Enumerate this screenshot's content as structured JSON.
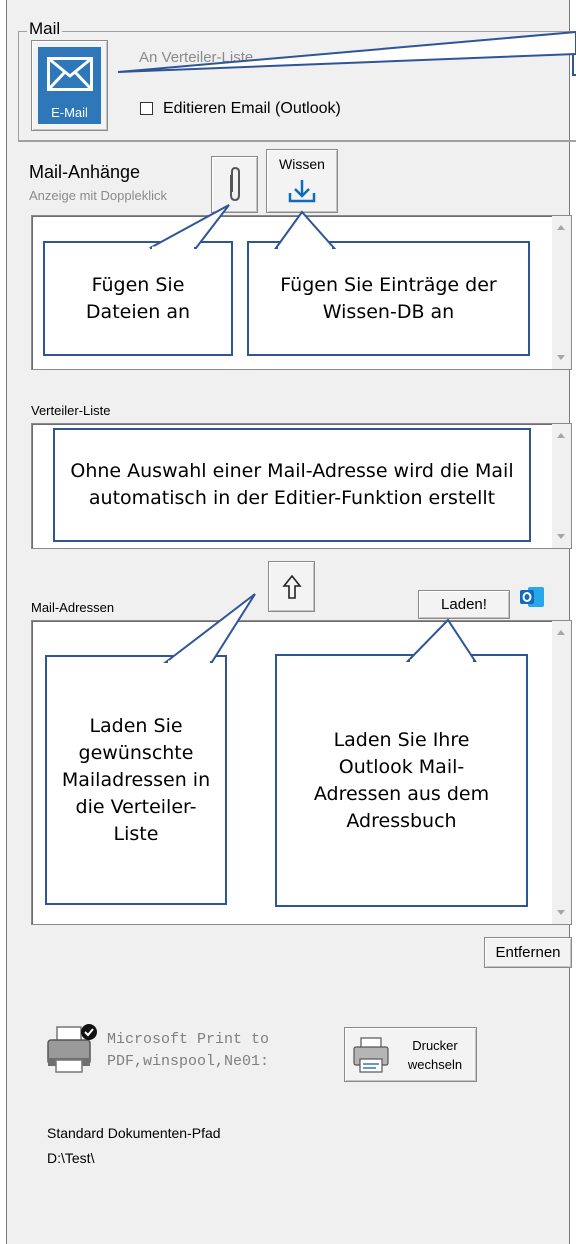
{
  "mail_group": {
    "title": "Mail",
    "email_button_label": "E-Mail",
    "distribution_hint": "An Verteiler-Liste",
    "edit_checkbox": {
      "label": "Editieren Email (Outlook)",
      "checked": false
    }
  },
  "attachments": {
    "title": "Mail-Anhänge",
    "subtitle": "Anzeige mit Doppleklick",
    "wissen_button_label": "Wissen"
  },
  "distribution_list": {
    "title": "Verteiler-Liste"
  },
  "mail_addresses": {
    "title": "Mail-Adressen",
    "load_button_label": "Laden!",
    "remove_button_label": "Entfernen"
  },
  "printer": {
    "name_line1": "Microsoft Print to",
    "name_line2": "PDF,winspool,Ne01:",
    "change_button_line1": "Drucker",
    "change_button_line2": "wechseln"
  },
  "document_path": {
    "title": "Standard Dokumenten-Pfad",
    "value": "D:\\Test\\"
  },
  "callouts": {
    "add_files": "Fügen Sie Dateien an",
    "add_wissen": "Fügen Sie Einträge der Wissen-DB an",
    "no_selection": "Ohne Auswahl einer Mail-Adresse wird die Mail automatisch in der Editier-Funktion erstellt",
    "load_addresses": "Laden Sie gewünschte Mailadressen in die Verteiler-Liste",
    "load_outlook": "Laden Sie Ihre Outlook Mail-Adressen aus dem Adressbuch"
  },
  "colors": {
    "callout_border": "#2f5597",
    "email_button": "#2e78b9",
    "outlook_blue": "#0f6cbd"
  }
}
